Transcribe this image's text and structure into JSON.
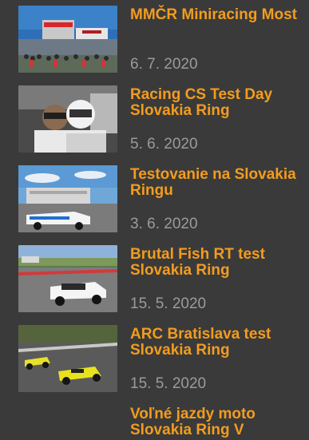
{
  "articles": [
    {
      "title": "MMČR Miniracing Most",
      "date": "6. 7. 2020",
      "thumbnail_icon": "race-track-crowd-photo"
    },
    {
      "title": "Racing CS Test Day Slovakia Ring",
      "date": "5. 6. 2020",
      "thumbnail_icon": "drivers-helmets-photo"
    },
    {
      "title": "Testovanie na Slovakia Ringu",
      "date": "3. 6. 2020",
      "thumbnail_icon": "race-car-pitlane-photo"
    },
    {
      "title": "Brutal Fish RT test Slovakia Ring",
      "date": "15. 5. 2020",
      "thumbnail_icon": "white-race-car-photo"
    },
    {
      "title": "ARC Bratislava test Slovakia Ring",
      "date": "15. 5. 2020",
      "thumbnail_icon": "yellow-prototypes-photo"
    },
    {
      "title": "Voľné jazdy moto Slovakia Ring V",
      "date": "",
      "thumbnail_icon": ""
    }
  ],
  "colors": {
    "background": "#3a3a3a",
    "title": "#f39c1e",
    "date": "#9b9b9b"
  }
}
